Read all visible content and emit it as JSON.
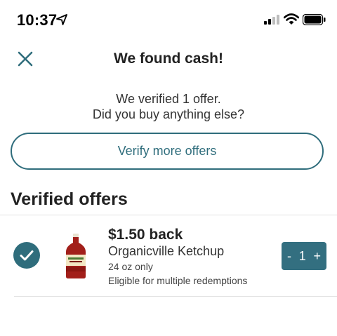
{
  "status_bar": {
    "time": "10:37"
  },
  "header": {
    "title": "We found cash!"
  },
  "message": {
    "line1": "We verified 1 offer.",
    "line2": "Did you buy anything else?"
  },
  "verify_button": {
    "label": "Verify more offers"
  },
  "section": {
    "title": "Verified offers"
  },
  "offer": {
    "amount": "$1.50 back",
    "name": "Organicville Ketchup",
    "size": "24 oz only",
    "note": "Eligible for multiple redemptions",
    "quantity": {
      "minus": "-",
      "value": "1",
      "plus": "+"
    }
  },
  "colors": {
    "accent": "#2f6d7c",
    "stepper_bg": "#336f80",
    "check_bg": "#2f6d7c"
  },
  "icons": [
    "location-arrow-icon",
    "signal-icon",
    "wifi-icon",
    "battery-icon",
    "close-icon",
    "checkmark-icon"
  ]
}
